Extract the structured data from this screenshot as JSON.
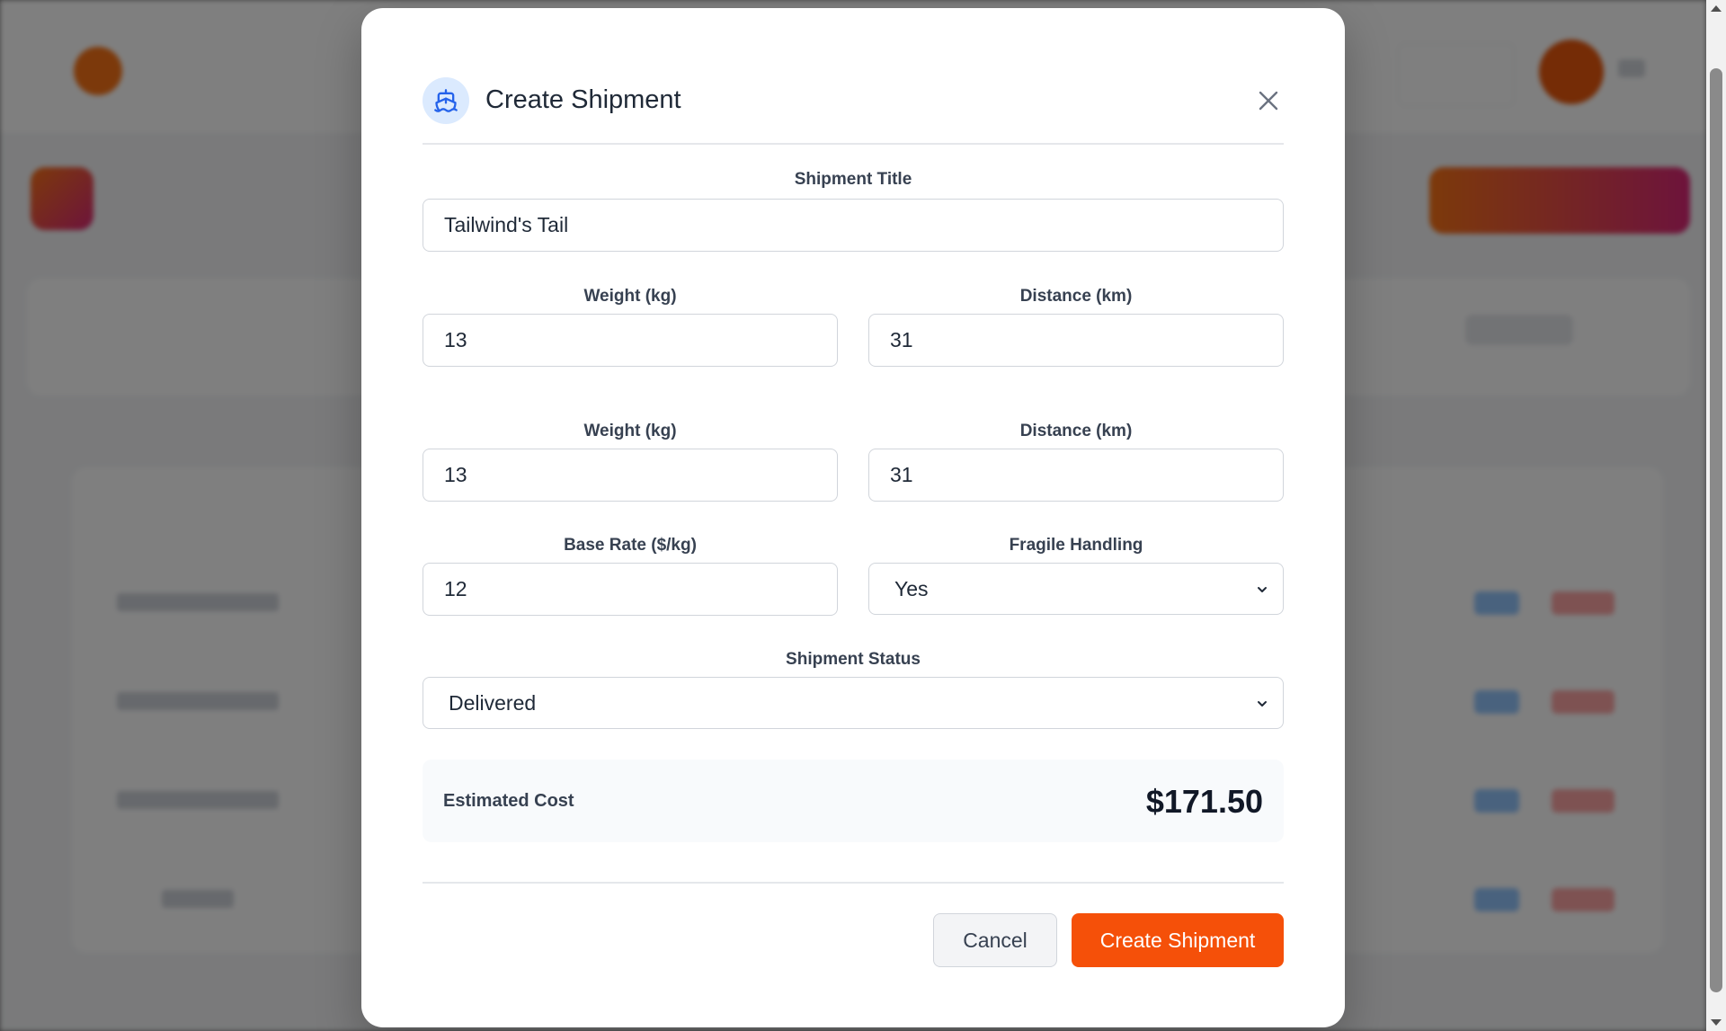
{
  "modal": {
    "title": "Create Shipment",
    "fields": {
      "shipment_title": {
        "label": "Shipment Title",
        "value": "Tailwind's Tail"
      },
      "weight": {
        "label": "Weight (kg)",
        "value": "13"
      },
      "distance": {
        "label": "Distance (km)",
        "value": "31"
      },
      "weight_dup": {
        "label": "Weight (kg)",
        "value": "13"
      },
      "distance_dup": {
        "label": "Distance (km)",
        "value": "31"
      },
      "base_rate": {
        "label": "Base Rate ($/kg)",
        "value": "12"
      },
      "fragile": {
        "label": "Fragile Handling",
        "selected": "Yes"
      },
      "status": {
        "label": "Shipment Status",
        "selected": "Delivered"
      }
    },
    "estimate": {
      "label": "Estimated Cost",
      "value": "$171.50"
    },
    "buttons": {
      "cancel": "Cancel",
      "create": "Create Shipment"
    }
  },
  "icons": {
    "title_icon": "ship-icon",
    "close": "close-icon",
    "select_chevron": "chevron-down-icon"
  },
  "colors": {
    "primary": "#f55009",
    "icon_bg": "#dbeafe",
    "icon_stroke": "#2563eb"
  }
}
